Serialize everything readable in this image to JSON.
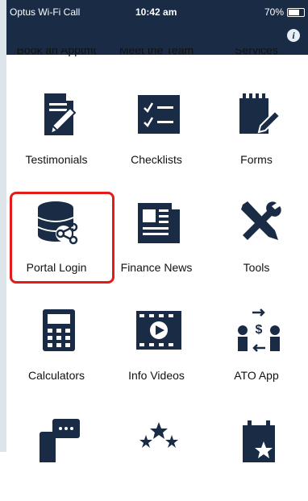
{
  "status_bar": {
    "carrier": "Optus Wi-Fi Call",
    "time": "10:42 am",
    "battery": "70%"
  },
  "header": {
    "info_label": "i"
  },
  "top_partial_labels": [
    "Book an Apptmt",
    "Meet the Team",
    "Services"
  ],
  "tiles": [
    {
      "label": "Testimonials",
      "icon": "document-pen-icon"
    },
    {
      "label": "Checklists",
      "icon": "checklist-icon"
    },
    {
      "label": "Forms",
      "icon": "notepad-pen-icon"
    },
    {
      "label": "Portal Login",
      "icon": "database-share-icon"
    },
    {
      "label": "Finance News",
      "icon": "newspaper-icon"
    },
    {
      "label": "Tools",
      "icon": "tools-icon"
    },
    {
      "label": "Calculators",
      "icon": "calculator-icon"
    },
    {
      "label": "Info Videos",
      "icon": "video-icon"
    },
    {
      "label": "ATO App",
      "icon": "people-exchange-icon"
    }
  ],
  "colors": {
    "header_bg": "#1a2c45",
    "icon_color": "#1a2c45",
    "highlight": "#e21b1b"
  }
}
